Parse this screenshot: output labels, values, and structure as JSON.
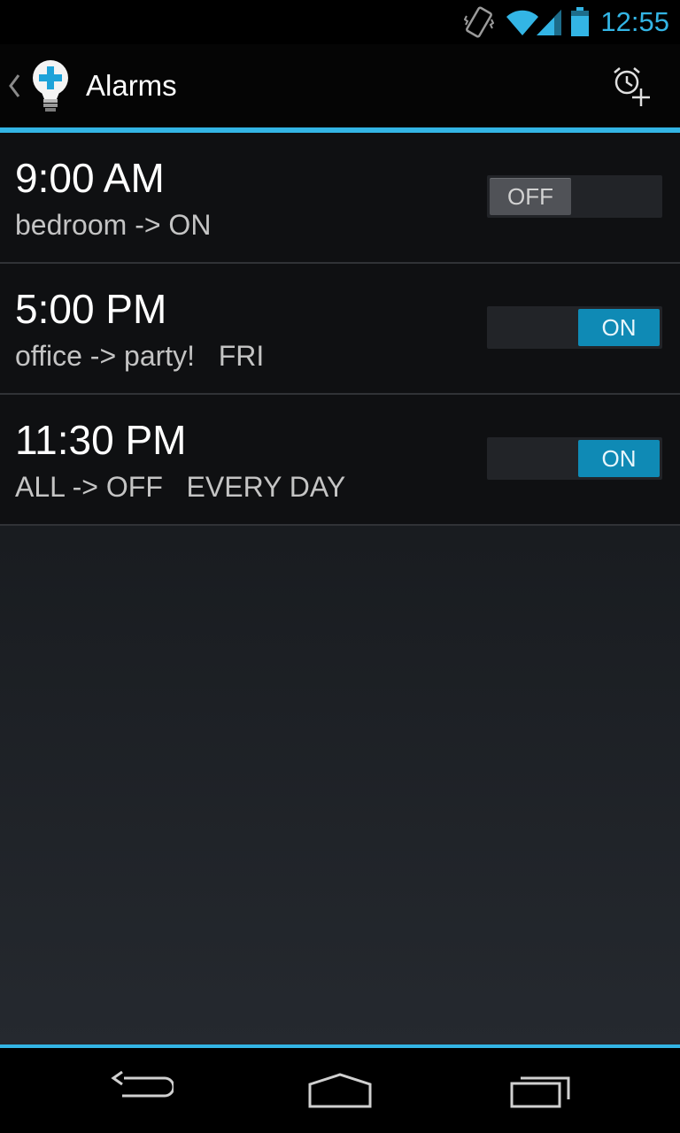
{
  "status": {
    "time": "12:55",
    "icons": [
      "vibrate-icon",
      "wifi-icon",
      "signal-icon",
      "battery-icon"
    ]
  },
  "actionbar": {
    "title": "Alarms",
    "icons": [
      "up-caret-icon",
      "lightbulb-plus-icon",
      "add-alarm-icon"
    ]
  },
  "alarms": [
    {
      "time": "9:00 AM",
      "description": "bedroom -> ON",
      "toggle_label": "OFF",
      "enabled": false
    },
    {
      "time": "5:00 PM",
      "description": "office -> party!   FRI",
      "toggle_label": "ON",
      "enabled": true
    },
    {
      "time": "11:30 PM",
      "description": "ALL -> OFF   EVERY DAY",
      "toggle_label": "ON",
      "enabled": true
    }
  ],
  "navbar": {
    "icons": [
      "back-icon",
      "home-icon",
      "recent-apps-icon"
    ]
  },
  "colors": {
    "accent": "#33b5e5",
    "toggle_on": "#0f8ab5",
    "toggle_off": "#505257"
  }
}
